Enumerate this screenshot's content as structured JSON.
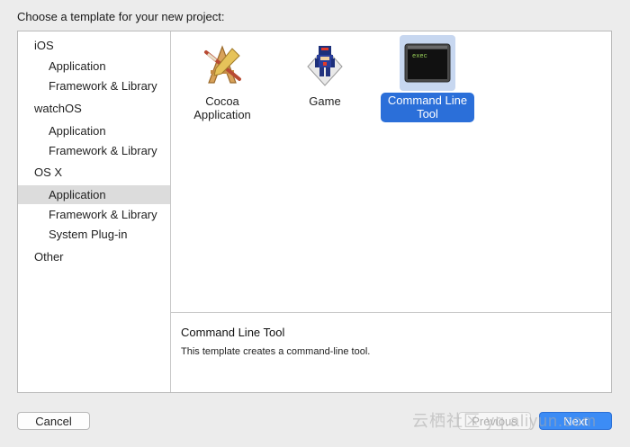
{
  "header": {
    "title": "Choose a template for your new project:"
  },
  "sidebar": {
    "groups": [
      {
        "label": "iOS",
        "items": [
          "Application",
          "Framework & Library"
        ]
      },
      {
        "label": "watchOS",
        "items": [
          "Application",
          "Framework & Library"
        ]
      },
      {
        "label": "OS X",
        "items": [
          "Application",
          "Framework & Library",
          "System Plug-in"
        ]
      },
      {
        "label": "Other",
        "items": []
      }
    ],
    "selected": "OS X / Application"
  },
  "templates": [
    {
      "label": "Cocoa\nApplication",
      "icon": "cocoa-app-icon"
    },
    {
      "label": "Game",
      "icon": "game-icon"
    },
    {
      "label": "Command Line\nTool",
      "icon": "terminal-icon",
      "selected": true,
      "icon_text": "exec"
    }
  ],
  "description": {
    "title": "Command Line Tool",
    "text": "This template creates a command-line tool."
  },
  "buttons": {
    "cancel": "Cancel",
    "previous": "Previous",
    "next": "Next"
  },
  "watermark": "云栖社区 yq.aliyun.com",
  "colors": {
    "accent": "#2b6fd9",
    "selection": "#dcdcdc",
    "next_button": "#3c8cf5"
  }
}
